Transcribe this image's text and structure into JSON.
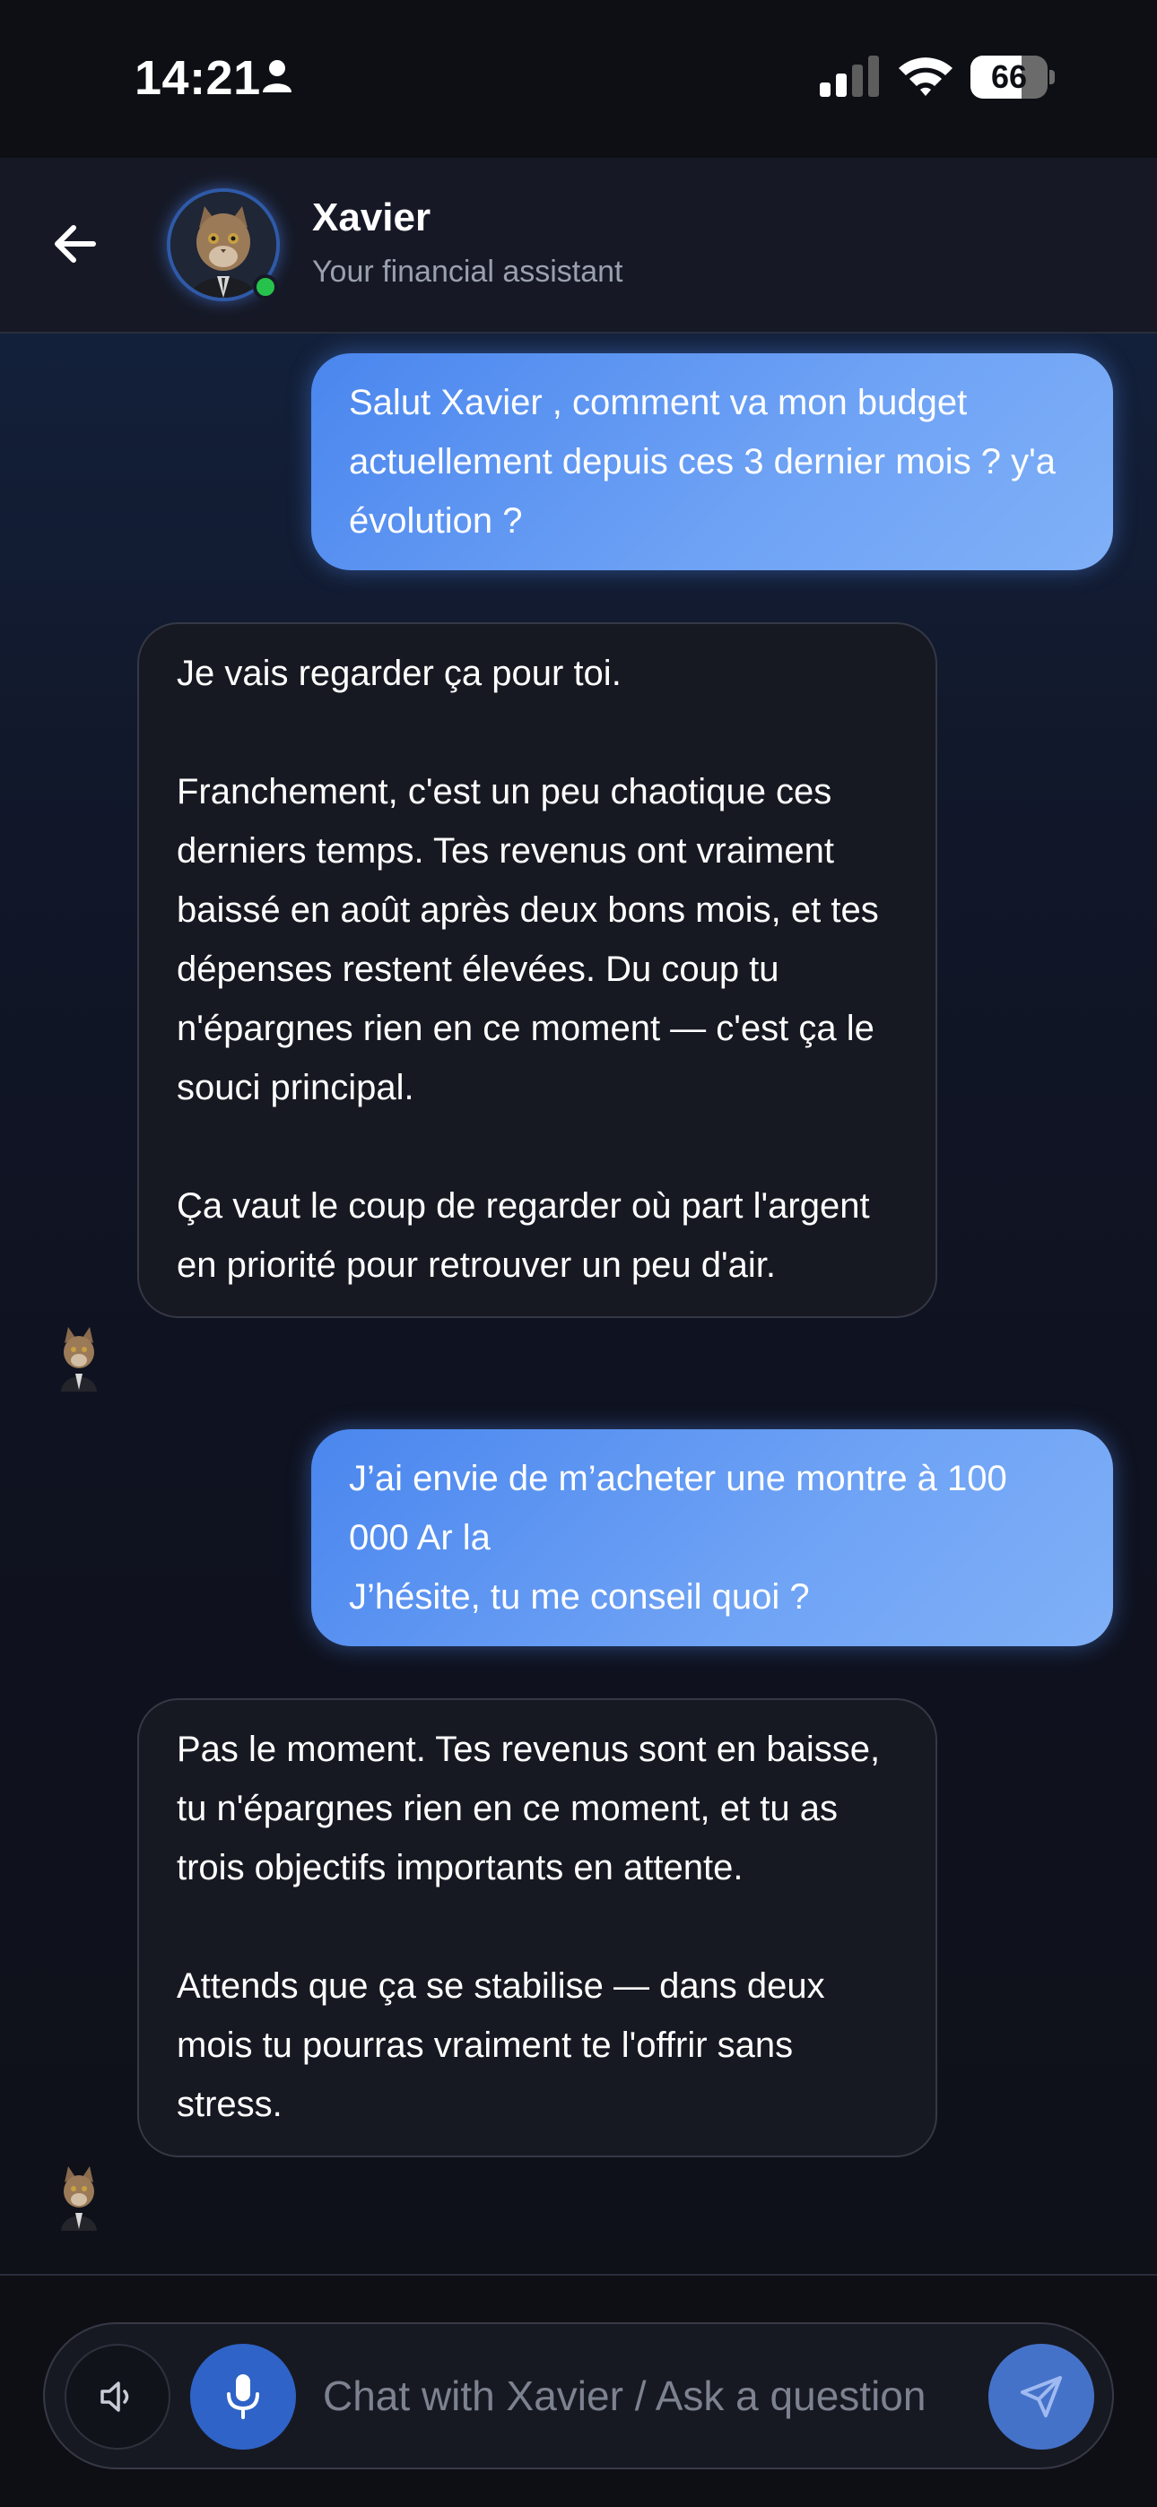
{
  "status_bar": {
    "time": "14:21",
    "battery_level": "66",
    "battery_fraction": 0.66,
    "icons": [
      "person-icon",
      "signal-icon",
      "wifi-icon",
      "battery-icon"
    ]
  },
  "header": {
    "contact_name": "Xavier",
    "contact_subtitle": "Your financial assistant",
    "online": true,
    "icons": [
      "back-arrow-icon",
      "avatar"
    ]
  },
  "messages": [
    {
      "sender": "user",
      "text": "Salut Xavier , comment va mon budget actuellement depuis ces 3 dernier mois ? y'a évolution ?"
    },
    {
      "sender": "assistant",
      "text": "Je vais regarder ça pour toi.\n\nFranchement, c'est un peu chaotique ces derniers temps. Tes revenus ont vraiment baissé en août après deux bons mois, et tes dépenses restent élevées. Du coup tu n'épargnes rien en ce moment — c'est ça le souci principal.\n\nÇa vaut le coup de regarder où part l'argent en priorité pour retrouver un peu d'air."
    },
    {
      "sender": "user",
      "text": "J’ai envie de m’acheter une montre à 100 000 Ar la\nJ’hésite, tu me conseil quoi ?"
    },
    {
      "sender": "assistant",
      "text": "Pas le moment. Tes revenus sont en baisse, tu n'épargnes rien en ce moment, et tu as trois objectifs importants en attente.\n\nAttends que ça se stabilise — dans deux mois tu pourras vraiment te l'offrir sans stress."
    }
  ],
  "composer": {
    "placeholder": "Chat with Xavier / Ask a question",
    "icons": [
      "speaker-icon",
      "microphone-icon",
      "send-icon"
    ]
  },
  "colors": {
    "background": "#0f1119",
    "user_bubble": "#5b95f2",
    "assistant_bubble": "#171922",
    "accent": "#2f63c7",
    "online": "#27c24c"
  }
}
